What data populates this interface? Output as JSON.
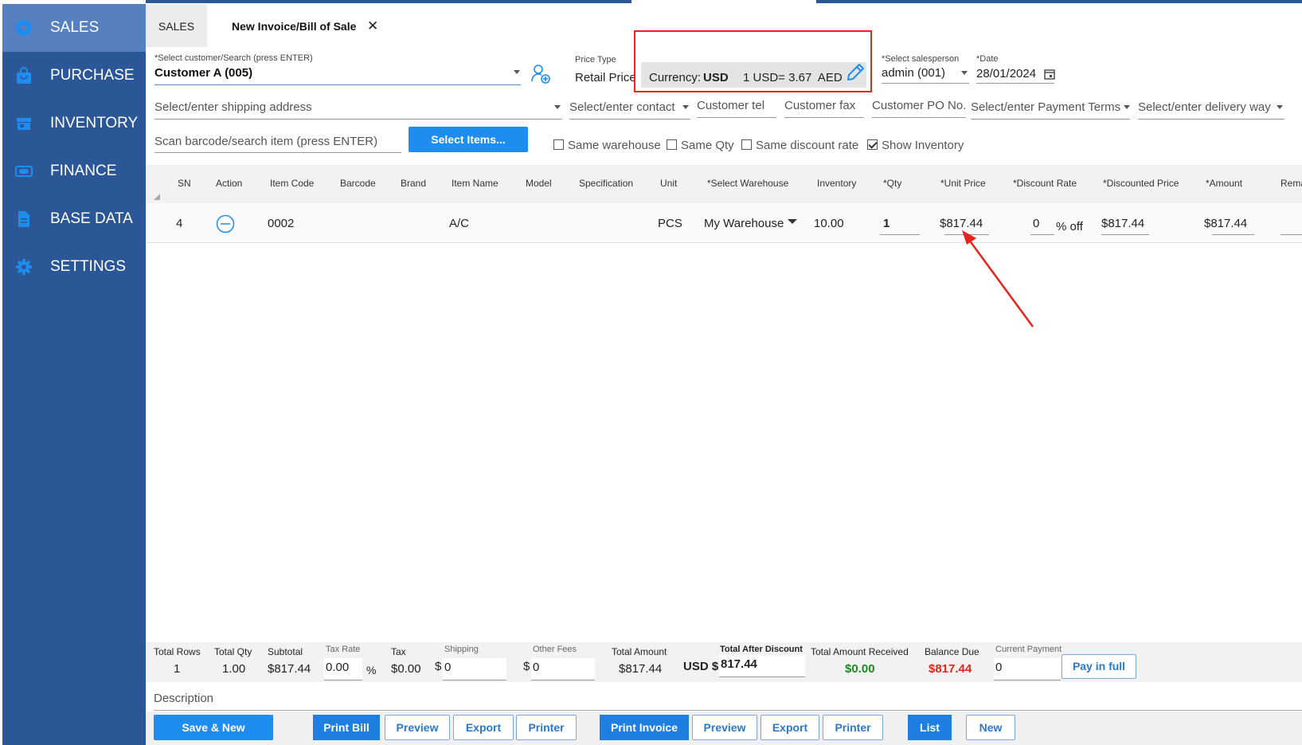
{
  "sidebar": {
    "items": [
      {
        "label": "SALES",
        "icon": "gear-badge-icon",
        "active": true
      },
      {
        "label": "PURCHASE",
        "icon": "shopping-bag-icon"
      },
      {
        "label": "INVENTORY",
        "icon": "store-icon"
      },
      {
        "label": "FINANCE",
        "icon": "money-icon"
      },
      {
        "label": "BASE DATA",
        "icon": "document-icon"
      },
      {
        "label": "SETTINGS",
        "icon": "gear-icon"
      }
    ]
  },
  "tabs": {
    "sales": "SALES",
    "invoice": "New Invoice/Bill of Sale",
    "close": "✕"
  },
  "form": {
    "customer_label": "*Select customer/Search (press ENTER)",
    "customer_value": "Customer A (005)",
    "price_type_label": "Price Type",
    "price_type_value": "Retail Price",
    "currency_label": "Currency:",
    "currency_value": "USD",
    "exchange_rate": "1 USD= 3.67  AED",
    "salesperson_label": "*Select salesperson",
    "salesperson_value": "admin (001)",
    "date_label": "*Date",
    "date_value": "28/01/2024",
    "shipping_placeholder": "Select/enter shipping address",
    "contact_placeholder": "Select/enter contact",
    "tel_placeholder": "Customer tel",
    "fax_placeholder": "Customer fax",
    "po_placeholder": "Customer PO No.",
    "payment_terms_placeholder": "Select/enter Payment Terms",
    "delivery_placeholder": "Select/enter delivery way",
    "barcode_placeholder": "Scan barcode/search item (press ENTER)",
    "select_items_button": "Select Items...",
    "checkboxes": [
      {
        "label": "Same warehouse",
        "checked": false
      },
      {
        "label": "Same Qty",
        "checked": false
      },
      {
        "label": "Same discount rate",
        "checked": false
      },
      {
        "label": "Show Inventory",
        "checked": true
      }
    ]
  },
  "grid": {
    "headers": [
      "SN",
      "Action",
      "Item Code",
      "Barcode",
      "Brand",
      "Item Name",
      "Model",
      "Specification",
      "Unit",
      "*Select Warehouse",
      "Inventory",
      "*Qty",
      "*Unit Price",
      "*Discount Rate",
      "*Discounted Price",
      "*Amount",
      "Rema"
    ],
    "row": {
      "sn": "4",
      "item_code": "0002",
      "item_name": "A/C",
      "unit": "PCS",
      "warehouse": "My Warehouse",
      "inventory": "10.00",
      "qty": "1",
      "unit_price": "$817.44",
      "discount_rate": "0",
      "discount_suffix": "% off",
      "discounted_price": "$817.44",
      "amount": "$817.44"
    }
  },
  "totals": {
    "total_rows_label": "Total Rows",
    "total_rows": "1",
    "total_qty_label": "Total Qty",
    "total_qty": "1.00",
    "subtotal_label": "Subtotal",
    "subtotal": "$817.44",
    "tax_rate_label": "Tax Rate",
    "tax_rate": "0.00",
    "tax_rate_suffix": "%",
    "tax_label": "Tax",
    "tax": "$0.00",
    "shipping_label": "Shipping",
    "shipping_prefix": "$",
    "shipping": "0",
    "other_fees_label": "Other Fees",
    "other_fees_prefix": "$",
    "other_fees": "0",
    "total_amount_label": "Total Amount",
    "total_amount": "$817.44",
    "after_discount_label": "Total After Discount",
    "after_discount_currency": "USD $",
    "after_discount": "817.44",
    "received_label": "Total Amount Received",
    "received": "$0.00",
    "balance_label": "Balance Due",
    "balance": "$817.44",
    "current_payment_label": "Current Payment",
    "current_payment": "0",
    "pay_full_button": "Pay in full"
  },
  "description_label": "Description",
  "actions": {
    "save_new": "Save & New",
    "print_bill": "Print Bill",
    "preview1": "Preview",
    "export1": "Export",
    "printer1": "Printer",
    "print_invoice": "Print Invoice",
    "preview2": "Preview",
    "export2": "Export",
    "printer2": "Printer",
    "list": "List",
    "new": "New"
  },
  "colors": {
    "sidebar": "#2c5796",
    "sidebar_active": "#5780c0",
    "primary_button": "#1f8cf0",
    "received_green": "#1a8a1a",
    "balance_red": "#e8221c",
    "annotation_red": "#e8221c"
  }
}
